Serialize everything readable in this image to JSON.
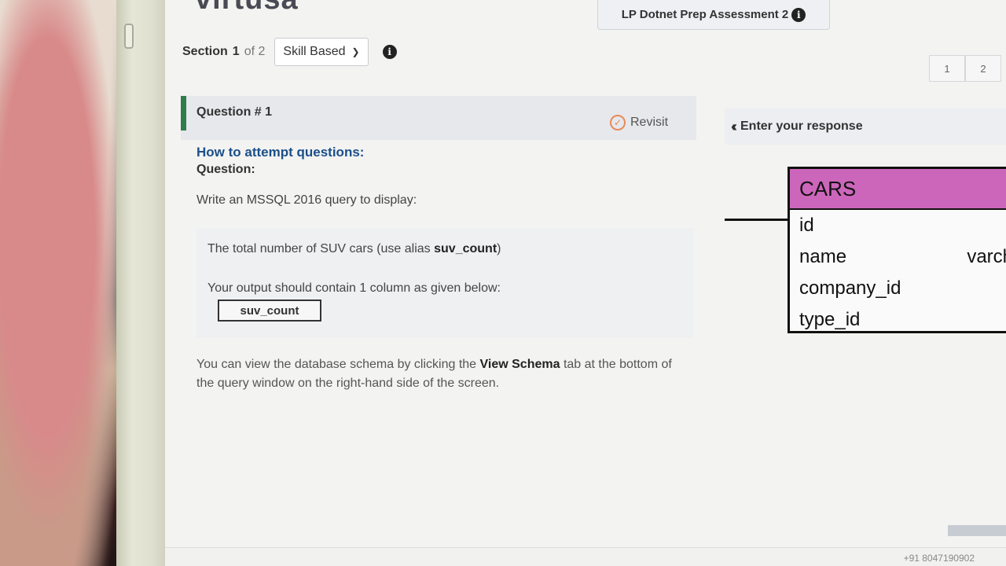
{
  "header": {
    "logo_text": "virtusa",
    "assessment_title": "LP Dotnet Prep Assessment 2",
    "info_icon": "i"
  },
  "section": {
    "label": "Section",
    "number": "1",
    "of_text": "of 2",
    "dropdown_value": "Skill Based",
    "info_icon": "i"
  },
  "pager": {
    "pages": [
      "1",
      "2"
    ]
  },
  "question": {
    "title": "Question # 1",
    "revisit_label": "Revisit",
    "how_to_link": "How to attempt questions:",
    "label": "Question:",
    "prompt": "Write an MSSQL 2016 query to display:",
    "box_line1_prefix": "The total number of SUV cars (use alias ",
    "box_line1_alias": "suv_count",
    "box_line1_suffix": ")",
    "box_line2": "Your output should contain 1 column as given below:",
    "column_name": "suv_count",
    "schema_note_prefix": "You can view the database schema by clicking the ",
    "schema_note_link": "View Schema",
    "schema_note_suffix": " tab at the bottom of the query window on the right-hand side of the screen."
  },
  "response": {
    "header": "Enter your response"
  },
  "er_table": {
    "name": "CARS",
    "header_color": "#cc66bb",
    "rows": [
      {
        "field": "id",
        "type": ""
      },
      {
        "field": "name",
        "type": "varch"
      },
      {
        "field": "company_id",
        "type": ""
      },
      {
        "field": "type_id",
        "type": ""
      }
    ]
  },
  "footer": {
    "phone": "+91 8047190902"
  }
}
